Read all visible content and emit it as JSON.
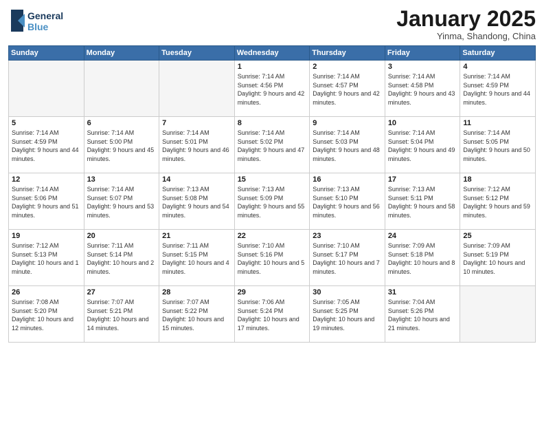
{
  "header": {
    "logo_line1": "General",
    "logo_line2": "Blue",
    "month_title": "January 2025",
    "subtitle": "Yinma, Shandong, China"
  },
  "days_of_week": [
    "Sunday",
    "Monday",
    "Tuesday",
    "Wednesday",
    "Thursday",
    "Friday",
    "Saturday"
  ],
  "weeks": [
    [
      {
        "day": "",
        "info": ""
      },
      {
        "day": "",
        "info": ""
      },
      {
        "day": "",
        "info": ""
      },
      {
        "day": "1",
        "info": "Sunrise: 7:14 AM\nSunset: 4:56 PM\nDaylight: 9 hours and 42 minutes."
      },
      {
        "day": "2",
        "info": "Sunrise: 7:14 AM\nSunset: 4:57 PM\nDaylight: 9 hours and 42 minutes."
      },
      {
        "day": "3",
        "info": "Sunrise: 7:14 AM\nSunset: 4:58 PM\nDaylight: 9 hours and 43 minutes."
      },
      {
        "day": "4",
        "info": "Sunrise: 7:14 AM\nSunset: 4:59 PM\nDaylight: 9 hours and 44 minutes."
      }
    ],
    [
      {
        "day": "5",
        "info": "Sunrise: 7:14 AM\nSunset: 4:59 PM\nDaylight: 9 hours and 44 minutes."
      },
      {
        "day": "6",
        "info": "Sunrise: 7:14 AM\nSunset: 5:00 PM\nDaylight: 9 hours and 45 minutes."
      },
      {
        "day": "7",
        "info": "Sunrise: 7:14 AM\nSunset: 5:01 PM\nDaylight: 9 hours and 46 minutes."
      },
      {
        "day": "8",
        "info": "Sunrise: 7:14 AM\nSunset: 5:02 PM\nDaylight: 9 hours and 47 minutes."
      },
      {
        "day": "9",
        "info": "Sunrise: 7:14 AM\nSunset: 5:03 PM\nDaylight: 9 hours and 48 minutes."
      },
      {
        "day": "10",
        "info": "Sunrise: 7:14 AM\nSunset: 5:04 PM\nDaylight: 9 hours and 49 minutes."
      },
      {
        "day": "11",
        "info": "Sunrise: 7:14 AM\nSunset: 5:05 PM\nDaylight: 9 hours and 50 minutes."
      }
    ],
    [
      {
        "day": "12",
        "info": "Sunrise: 7:14 AM\nSunset: 5:06 PM\nDaylight: 9 hours and 51 minutes."
      },
      {
        "day": "13",
        "info": "Sunrise: 7:14 AM\nSunset: 5:07 PM\nDaylight: 9 hours and 53 minutes."
      },
      {
        "day": "14",
        "info": "Sunrise: 7:13 AM\nSunset: 5:08 PM\nDaylight: 9 hours and 54 minutes."
      },
      {
        "day": "15",
        "info": "Sunrise: 7:13 AM\nSunset: 5:09 PM\nDaylight: 9 hours and 55 minutes."
      },
      {
        "day": "16",
        "info": "Sunrise: 7:13 AM\nSunset: 5:10 PM\nDaylight: 9 hours and 56 minutes."
      },
      {
        "day": "17",
        "info": "Sunrise: 7:13 AM\nSunset: 5:11 PM\nDaylight: 9 hours and 58 minutes."
      },
      {
        "day": "18",
        "info": "Sunrise: 7:12 AM\nSunset: 5:12 PM\nDaylight: 9 hours and 59 minutes."
      }
    ],
    [
      {
        "day": "19",
        "info": "Sunrise: 7:12 AM\nSunset: 5:13 PM\nDaylight: 10 hours and 1 minute."
      },
      {
        "day": "20",
        "info": "Sunrise: 7:11 AM\nSunset: 5:14 PM\nDaylight: 10 hours and 2 minutes."
      },
      {
        "day": "21",
        "info": "Sunrise: 7:11 AM\nSunset: 5:15 PM\nDaylight: 10 hours and 4 minutes."
      },
      {
        "day": "22",
        "info": "Sunrise: 7:10 AM\nSunset: 5:16 PM\nDaylight: 10 hours and 5 minutes."
      },
      {
        "day": "23",
        "info": "Sunrise: 7:10 AM\nSunset: 5:17 PM\nDaylight: 10 hours and 7 minutes."
      },
      {
        "day": "24",
        "info": "Sunrise: 7:09 AM\nSunset: 5:18 PM\nDaylight: 10 hours and 8 minutes."
      },
      {
        "day": "25",
        "info": "Sunrise: 7:09 AM\nSunset: 5:19 PM\nDaylight: 10 hours and 10 minutes."
      }
    ],
    [
      {
        "day": "26",
        "info": "Sunrise: 7:08 AM\nSunset: 5:20 PM\nDaylight: 10 hours and 12 minutes."
      },
      {
        "day": "27",
        "info": "Sunrise: 7:07 AM\nSunset: 5:21 PM\nDaylight: 10 hours and 14 minutes."
      },
      {
        "day": "28",
        "info": "Sunrise: 7:07 AM\nSunset: 5:22 PM\nDaylight: 10 hours and 15 minutes."
      },
      {
        "day": "29",
        "info": "Sunrise: 7:06 AM\nSunset: 5:24 PM\nDaylight: 10 hours and 17 minutes."
      },
      {
        "day": "30",
        "info": "Sunrise: 7:05 AM\nSunset: 5:25 PM\nDaylight: 10 hours and 19 minutes."
      },
      {
        "day": "31",
        "info": "Sunrise: 7:04 AM\nSunset: 5:26 PM\nDaylight: 10 hours and 21 minutes."
      },
      {
        "day": "",
        "info": ""
      }
    ]
  ]
}
